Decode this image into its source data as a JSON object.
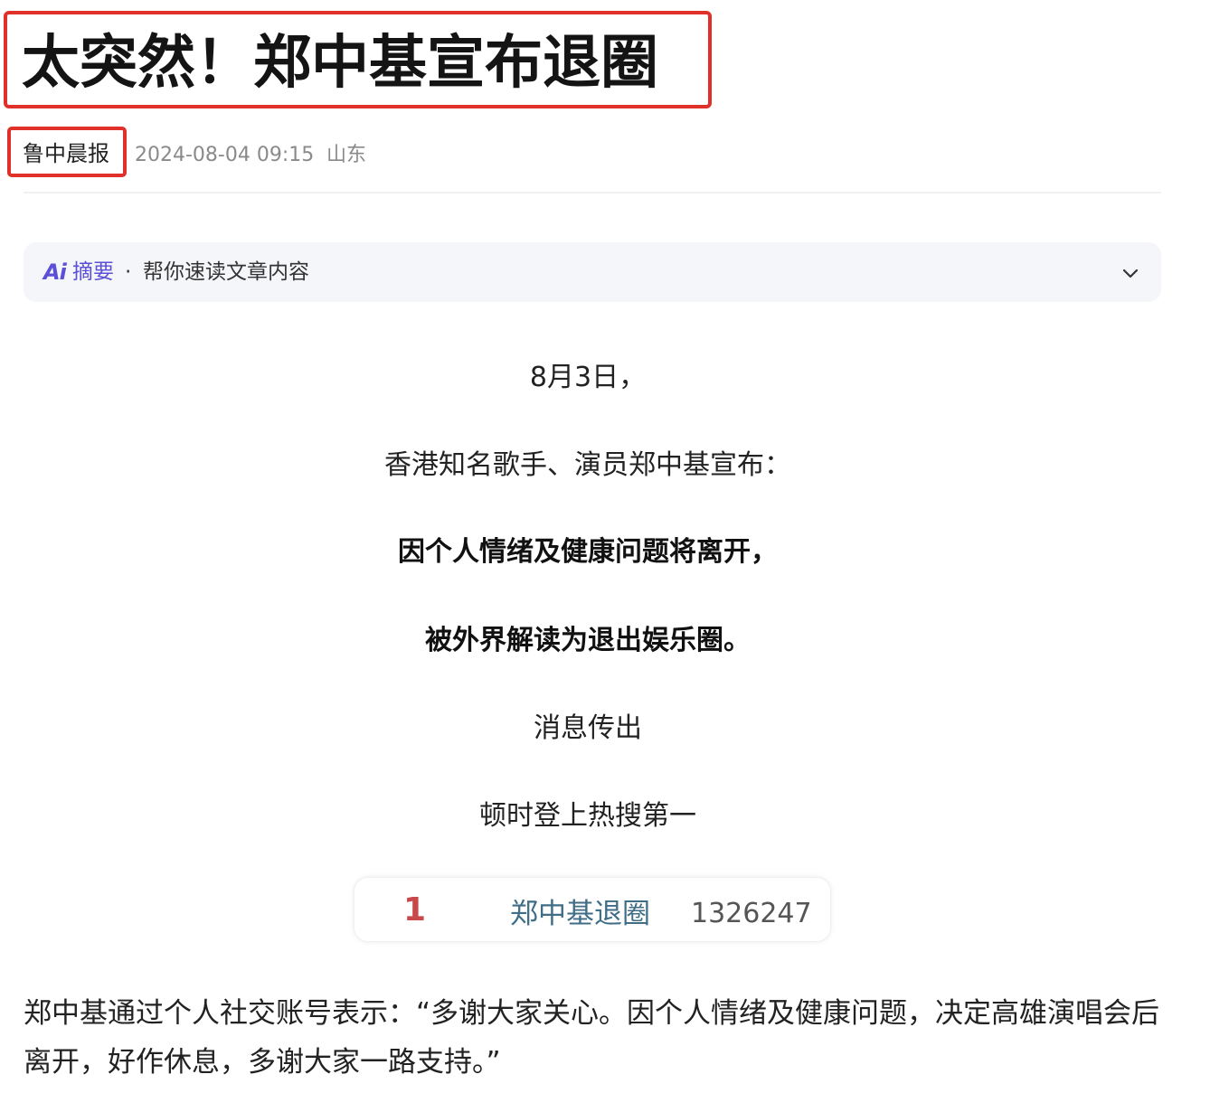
{
  "article": {
    "title": "太突然！郑中基宣布退圈",
    "meta": {
      "source": "鲁中晨报",
      "datetime": "2024-08-04 09:15",
      "location": "山东"
    },
    "summary": {
      "ai_logo": "Ai",
      "label": "摘要",
      "separator": "·",
      "description": "帮你速读文章内容",
      "accent_color": "#5b50d6"
    },
    "paragraphs_centered": [
      "8月3日，",
      "香港知名歌手、演员郑中基宣布：",
      "因个人情绪及健康问题将离开，",
      "被外界解读为退出娱乐圈。",
      "消息传出",
      "顿时登上热搜第一"
    ],
    "trending": {
      "rank": "1",
      "topic": "郑中基退圈",
      "count": "1326247"
    },
    "body_paragraph": "郑中基通过个人社交账号表示：“多谢大家关心。因个人情绪及健康问题，决定高雄演唱会后离开，好作休息，多谢大家一路支持。”"
  },
  "annotations": {
    "highlight_color": "#e0302a"
  }
}
